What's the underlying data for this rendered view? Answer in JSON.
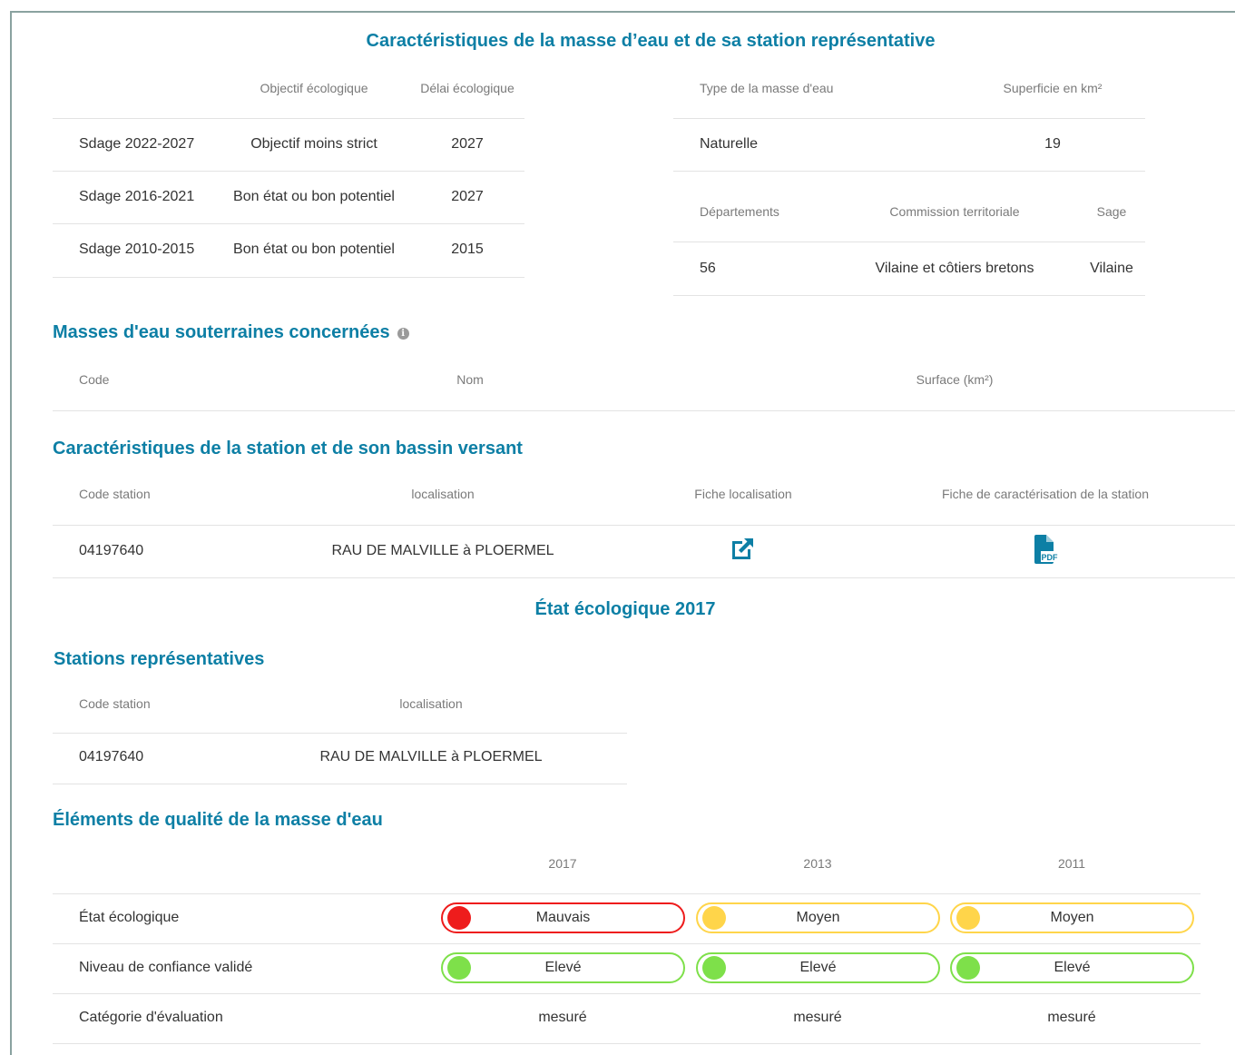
{
  "main_title": "Caractéristiques de la masse d’eau et de sa station représentative",
  "objectives_table": {
    "headers": [
      "Objectif écologique",
      "Délai écologique"
    ],
    "rows": [
      {
        "label": "Sdage 2022-2027",
        "objective": "Objectif moins strict",
        "delay": "2027"
      },
      {
        "label": "Sdage 2016-2021",
        "objective": "Bon état ou bon potentiel",
        "delay": "2027"
      },
      {
        "label": "Sdage 2010-2015",
        "objective": "Bon état ou bon potentiel",
        "delay": "2015"
      }
    ]
  },
  "type_table": {
    "headers": [
      "Type de la masse d'eau",
      "Superficie en km²"
    ],
    "row": {
      "type": "Naturelle",
      "area": "19"
    }
  },
  "dept_table": {
    "headers": [
      "Départements",
      "Commission territoriale",
      "Sage"
    ],
    "row": {
      "dept": "56",
      "commission": "Vilaine et côtiers bretons",
      "sage": "Vilaine"
    }
  },
  "groundwater": {
    "title": "Masses d'eau souterraines concernées",
    "info_icon": "i",
    "headers": [
      "Code",
      "Nom",
      "Surface (km²)"
    ]
  },
  "station": {
    "title": "Caractéristiques de la station et de son bassin versant",
    "headers": [
      "Code station",
      "localisation",
      "Fiche localisation",
      "Fiche de caractérisation de la station"
    ],
    "row": {
      "code": "04197640",
      "location": "RAU DE MALVILLE à PLOERMEL"
    },
    "icons": {
      "localisation": "external-link-icon",
      "pdf": "pdf-file-icon"
    },
    "pdf_badge": "PDF"
  },
  "eco_state_title": "État écologique 2017",
  "rep_stations": {
    "title": "Stations représentatives",
    "headers": [
      "Code station",
      "localisation"
    ],
    "row": {
      "code": "04197640",
      "location": "RAU DE MALVILLE à PLOERMEL"
    }
  },
  "quality": {
    "title": "Éléments de qualité de la masse d'eau",
    "years": [
      "2017",
      "2013",
      "2011"
    ],
    "rows": [
      {
        "label": "État écologique",
        "values": [
          {
            "text": "Mauvais",
            "color": "#ee1c1c"
          },
          {
            "text": "Moyen",
            "color": "#ffd54a"
          },
          {
            "text": "Moyen",
            "color": "#ffd54a"
          }
        ]
      },
      {
        "label": "Niveau de confiance validé",
        "values": [
          {
            "text": "Elevé",
            "color": "#7ee04a"
          },
          {
            "text": "Elevé",
            "color": "#7ee04a"
          },
          {
            "text": "Elevé",
            "color": "#7ee04a"
          }
        ]
      },
      {
        "label": "Catégorie d'évaluation",
        "values": [
          {
            "text": "mesuré"
          },
          {
            "text": "mesuré"
          },
          {
            "text": "mesuré"
          }
        ]
      }
    ]
  },
  "colors": {
    "accent": "#0d7fa5",
    "red": "#ee1c1c",
    "yellow": "#ffd54a",
    "green": "#7ee04a"
  }
}
